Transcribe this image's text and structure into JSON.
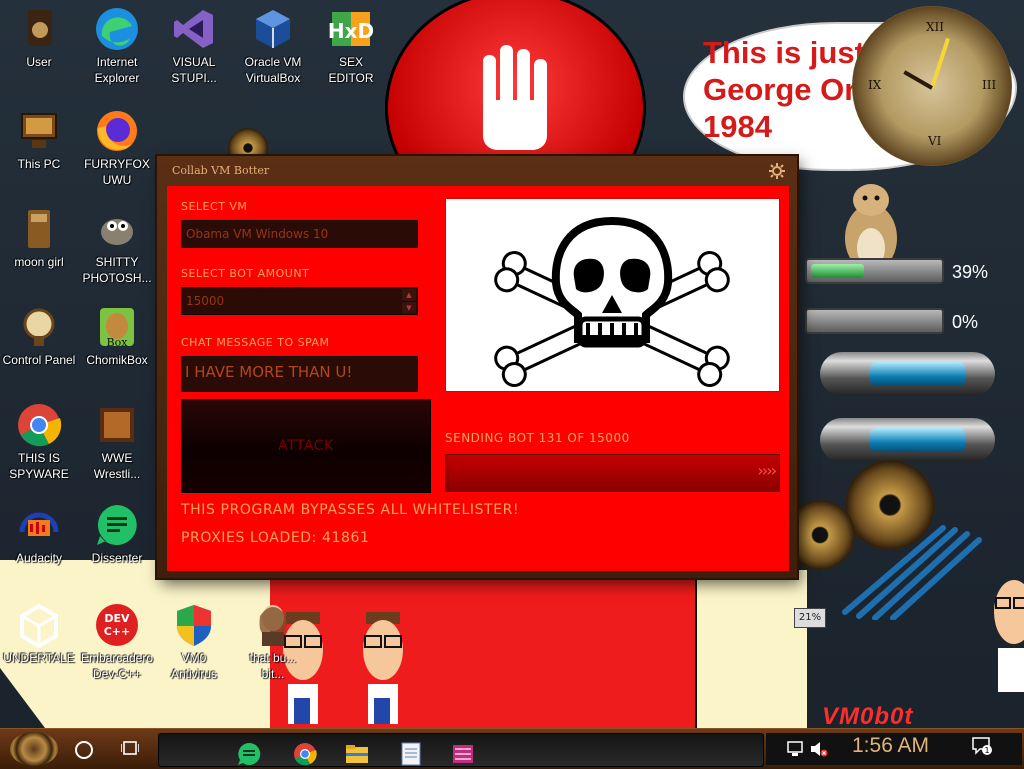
{
  "desktop": {
    "icons": [
      {
        "label": "User",
        "icon": "user-folder-icon"
      },
      {
        "label": "Internet\nExplorer",
        "icon": "edge-icon"
      },
      {
        "label": "VISUAL\nSTUPI...",
        "icon": "visual-studio-icon"
      },
      {
        "label": "Oracle VM\nVirtualBox",
        "icon": "virtualbox-icon"
      },
      {
        "label": "SEX\nEDITOR",
        "icon": "hex-editor-icon"
      },
      {
        "label": "This PC",
        "icon": "this-pc-icon"
      },
      {
        "label": "FURRYFOX\nUWU",
        "icon": "firefox-icon"
      },
      {
        "label": "moon girl",
        "icon": "moon-girl-icon"
      },
      {
        "label": "SHITTY\nPHOTOSH...",
        "icon": "gimp-icon"
      },
      {
        "label": "Control Panel",
        "icon": "control-panel-icon"
      },
      {
        "label": "ChomikBox",
        "icon": "chomikbox-icon"
      },
      {
        "label": "THIS IS\nSPYWARE",
        "icon": "chrome-icon"
      },
      {
        "label": "WWE\nWrestli...",
        "icon": "wwe-icon"
      },
      {
        "label": "Audacity",
        "icon": "audacity-icon"
      },
      {
        "label": "Dissenter",
        "icon": "dissenter-icon"
      },
      {
        "label": "UNDERTALE",
        "icon": "unity-icon"
      },
      {
        "label": "Embarcadero\nDev-C++",
        "icon": "devcpp-icon"
      },
      {
        "label": "VM0\nAntivirus",
        "icon": "shield-icon"
      },
      {
        "label": "that bu...\nbit...",
        "icon": "portrait-icon"
      }
    ]
  },
  "wallpaper": {
    "orwell_text": "This is just like\nGeorge Orwell's\n1984",
    "vmob_text": "VM0b0t",
    "gauges": [
      {
        "value_label": "39%",
        "fraction": 0.39
      },
      {
        "value_label": "0%",
        "fraction": 0.0
      }
    ],
    "chip": "21%"
  },
  "window": {
    "title": "Collab VM Botter",
    "select_vm_label": "SELECT VM",
    "select_vm_value": "Obama VM Windows 10",
    "bot_amount_label": "SELECT BOT AMOUNT",
    "bot_amount_value": "15000",
    "chat_label": "CHAT MESSAGE TO SPAM",
    "chat_value": "I HAVE MORE THAN U!",
    "attack_label": "ATTACK",
    "status_label": "SENDING BOT 131 OF 15000",
    "progress_fraction": 0.0087,
    "bypass_text": "THIS PROGRAM BYPASSES ALL WHITELISTER!",
    "proxies_text": "PROXIES LOADED: 41861",
    "image_icon": "skull-crossbones-icon"
  },
  "taskbar": {
    "apps": [
      "dissenter-icon",
      "chrome-icon",
      "file-explorer-icon",
      "notepad-icon",
      "winrar-icon"
    ],
    "clock": "1:56 AM",
    "notification_count": "1"
  },
  "colors": {
    "window_client": "#ff0000",
    "label_orange": "#ffa35a",
    "field_bg": "#2a0b06",
    "taskbar_brown": "#5a2f14",
    "clock_text": "#e1b476"
  }
}
